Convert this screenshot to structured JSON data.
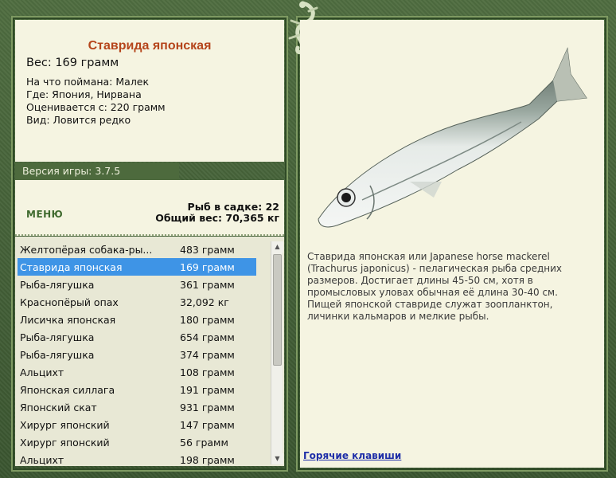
{
  "fish": {
    "title": "Ставрида японская",
    "weight": "Вес: 169 грамм",
    "caught_on": "На что поймана: Малек",
    "location": "Где: Япония, Нирвана",
    "valued_from": "Оценивается с: 220 грамм",
    "rarity": "Вид: Ловится редко"
  },
  "version": "Версия игры: 3.7.5",
  "menu_label": "МЕНЮ",
  "stats": {
    "fish_in_keepnet": "Рыб в садке: 22",
    "total_weight": "Общий вес: 70,365 кг"
  },
  "list": [
    {
      "name": "Желтопёрая собака-ры...",
      "weight": "483 грамм"
    },
    {
      "name": "Ставрида японская",
      "weight": "169 грамм",
      "selected": true
    },
    {
      "name": "Рыба-лягушка",
      "weight": "361 грамм"
    },
    {
      "name": "Краснопёрый опах",
      "weight": "32,092 кг"
    },
    {
      "name": "Лисичка японская",
      "weight": "180 грамм"
    },
    {
      "name": "Рыба-лягушка",
      "weight": "654 грамм"
    },
    {
      "name": "Рыба-лягушка",
      "weight": "374 грамм"
    },
    {
      "name": "Альцихт",
      "weight": "108 грамм"
    },
    {
      "name": "Японская силлага",
      "weight": "191 грамм"
    },
    {
      "name": "Японский скат",
      "weight": "931 грамм"
    },
    {
      "name": "Хирург японский",
      "weight": "147 грамм"
    },
    {
      "name": "Хирург японский",
      "weight": "56 грамм"
    },
    {
      "name": "Альцихт",
      "weight": "198 грамм"
    }
  ],
  "description": "Ставрида японская или Japanese horse mackerel (Trachurus japonicus) - пелагическая рыба средних размеров. Достигает длины 45-50 см, хотя в промысловых уловах обычная её длина 30-40 см. Пищей японской ставриде служат зоопланктон, личинки кальмаров и мелкие рыбы.",
  "hotkeys_label": "Горячие клавиши",
  "colors": {
    "accent_title": "#b5451b",
    "selection": "#3e94e6",
    "frame": "#4d6a3d"
  },
  "icons": {
    "ornament": "lizard-icon",
    "scroll_up": "arrow-up-icon",
    "scroll_down": "arrow-down-icon"
  }
}
